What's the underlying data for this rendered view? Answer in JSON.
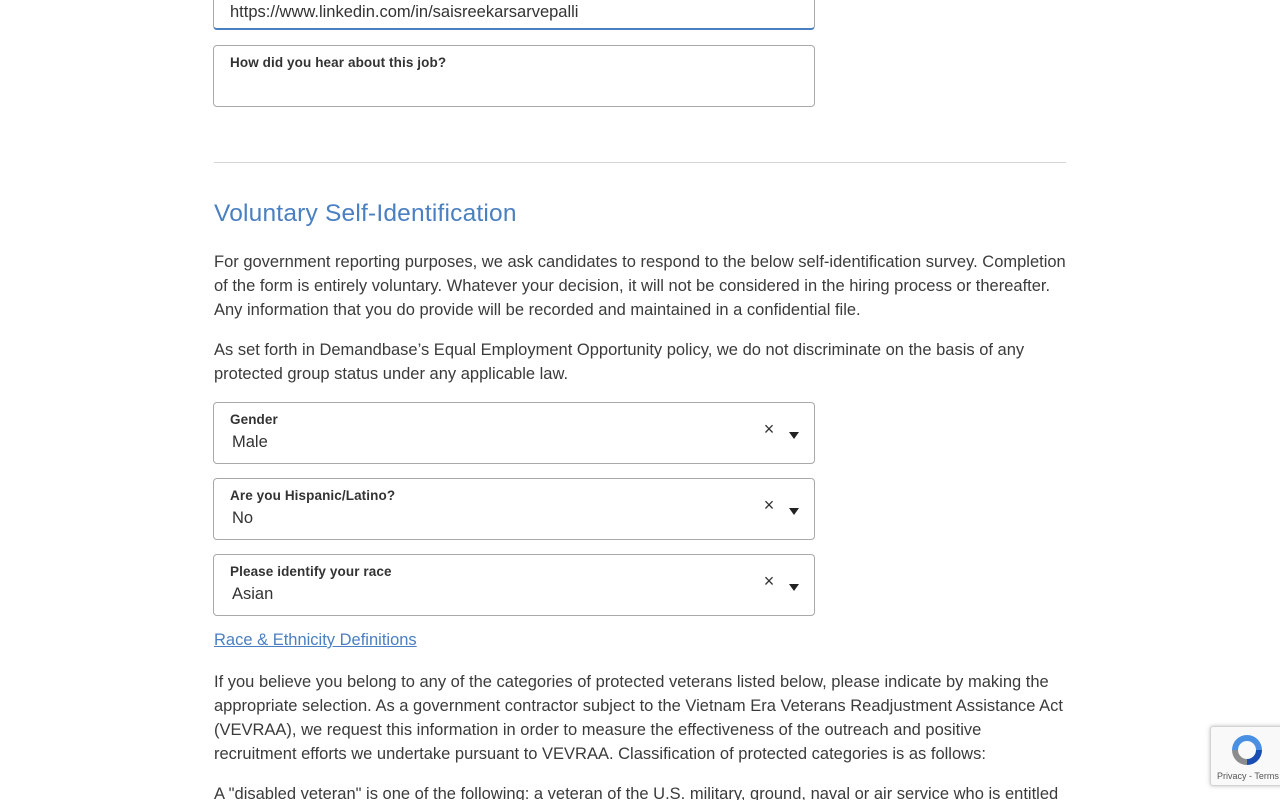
{
  "linkedin_field": {
    "value": "https://www.linkedin.com/in/saisreekarsarvepalli"
  },
  "referral_field": {
    "label": "How did you hear about this job?",
    "value": ""
  },
  "self_id": {
    "title": "Voluntary Self-Identification",
    "intro": "For government reporting purposes, we ask candidates to respond to the below self-identification survey. Completion of the form is entirely voluntary. Whatever your decision, it will not be considered in the hiring process or thereafter. Any information that you do provide will be recorded and maintained in a confidential file.",
    "eeo": "As set forth in Demandbase’s Equal Employment Opportunity policy, we do not discriminate on the basis of any protected group status under any applicable law.",
    "gender": {
      "label": "Gender",
      "value": "Male"
    },
    "hispanic": {
      "label": "Are you Hispanic/Latino?",
      "value": "No"
    },
    "race": {
      "label": "Please identify your race",
      "value": "Asian"
    },
    "race_link": "Race & Ethnicity Definitions",
    "veteran_intro": "If you believe you belong to any of the categories of protected veterans listed below, please indicate by making the appropriate selection. As a government contractor subject to the Vietnam Era Veterans Readjustment Assistance Act (VEVRAA), we request this information in order to measure the effectiveness of the outreach and positive recruitment efforts we undertake pursuant to VEVRAA. Classification of protected categories is as follows:",
    "disabled_veteran": "A \"disabled veteran\" is one of the following: a veteran of the U.S. military, ground, naval or air service who is entitled"
  },
  "icons": {
    "clear": "close-icon",
    "dropdown": "chevron-down-icon"
  },
  "recaptcha": {
    "footer": "Privacy - Terms"
  },
  "colors": {
    "accent": "#4a7fc1",
    "text": "#3b3b3b",
    "border": "#a9a9a9"
  }
}
